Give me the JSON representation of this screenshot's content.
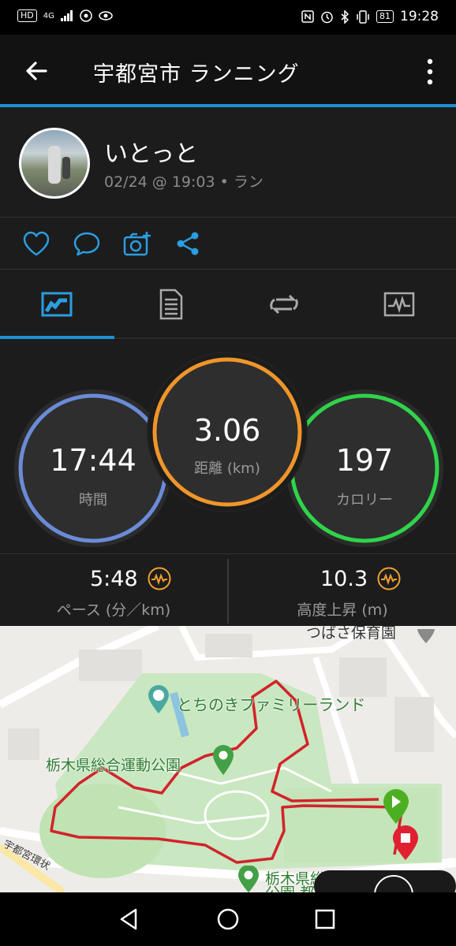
{
  "status_bar": {
    "left_icons": [
      "HD",
      "4G",
      "signal-icon",
      "location-icon",
      "eye-icon"
    ],
    "battery": "81",
    "time": "19:28",
    "right_icons": [
      "nfc-icon",
      "alarm-icon",
      "bluetooth-icon",
      "vibrate-icon",
      "battery-icon"
    ]
  },
  "header": {
    "title": "宇都宮市 ランニング",
    "back_icon": "back-arrow-icon",
    "more_icon": "more-vert-icon"
  },
  "profile": {
    "name": "いとっと",
    "meta": "02/24 @ 19:03 • ラン"
  },
  "actions": [
    "like-icon",
    "comment-icon",
    "add-photo-icon",
    "share-icon"
  ],
  "tabs": [
    "overview-icon",
    "details-icon",
    "laps-icon",
    "charts-icon"
  ],
  "stats": {
    "time": {
      "value": "17:44",
      "label": "時間"
    },
    "distance": {
      "value": "3.06",
      "label": "距離 (km)"
    },
    "calories": {
      "value": "197",
      "label": "カロリー"
    }
  },
  "bottom_stats": {
    "pace": {
      "value": "5:48",
      "label": "ペース (分／km)"
    },
    "elevation": {
      "value": "10.3",
      "label": "高度上昇 (m)"
    }
  },
  "map": {
    "labels": {
      "nursery": "つばさ保育園",
      "family_land": "とちのきファミリーランド",
      "park": "栃木県総合運動公園",
      "park2": "栃木県総合運動",
      "park3": "公園 都",
      "road": "宇都宮環状"
    },
    "route_color": "#d2232a",
    "start_marker_color": "#4caf22",
    "end_marker_color": "#e02030"
  },
  "colors": {
    "time_ring": "#6b8bd8",
    "distance_ring": "#f0952a",
    "calories_ring": "#2fd44a",
    "accent": "#1e90d6"
  }
}
